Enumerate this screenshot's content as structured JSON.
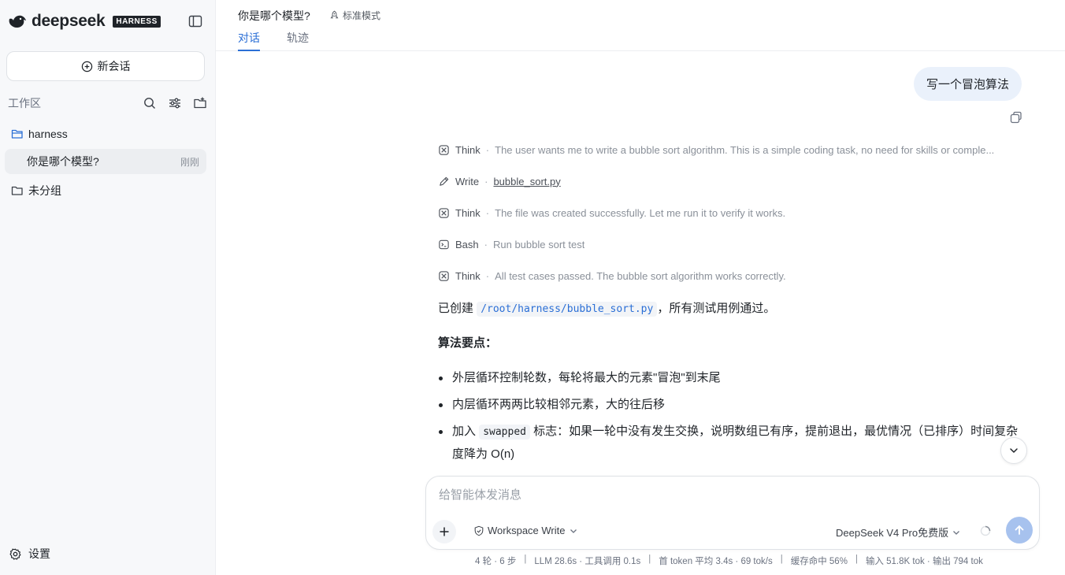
{
  "brand": {
    "wordmark": "deepseek",
    "badge": "HARNESS"
  },
  "sidebar": {
    "new_chat_label": "新会话",
    "workspace_label": "工作区",
    "groups": [
      {
        "label": "harness"
      },
      {
        "label": "未分组"
      }
    ],
    "sessions": [
      {
        "title": "你是哪个模型?",
        "time": "刚刚"
      }
    ],
    "settings_label": "设置"
  },
  "header": {
    "title": "你是哪个模型?",
    "mode": "标准模式",
    "tabs": [
      {
        "label": "对话",
        "active": true
      },
      {
        "label": "轨迹",
        "active": false
      }
    ]
  },
  "conversation": {
    "user_message": "写一个冒泡算法",
    "steps": [
      {
        "type": "Think",
        "icon": "brain-icon",
        "desc": "The user wants me to write a bubble sort algorithm. This is a simple coding task, no need for skills or comple..."
      },
      {
        "type": "Write",
        "icon": "pencil-icon",
        "link": "bubble_sort.py"
      },
      {
        "type": "Think",
        "icon": "brain-icon",
        "desc": "The file was created successfully. Let me run it to verify it works."
      },
      {
        "type": "Bash",
        "icon": "terminal-icon",
        "desc": "Run bubble sort test"
      },
      {
        "type": "Think",
        "icon": "brain-icon",
        "desc": "All test cases passed. The bubble sort algorithm works correctly."
      }
    ],
    "separator": "·",
    "answer": {
      "prefix": "已创建",
      "path": "/root/harness/bubble_sort.py",
      "suffix": "，所有测试用例通过。",
      "heading": "算法要点：",
      "bullets": [
        {
          "text": "外层循环控制轮数，每轮将最大的元素\"冒泡\"到末尾"
        },
        {
          "text": "内层循环两两比较相邻元素，大的往后移"
        },
        {
          "before": "加入",
          "code": "swapped",
          "after": "标志：如果一轮中没有发生交换，说明数组已有序，提前退出，最优情况（已排序）时间复杂度降为 O(n)"
        }
      ]
    }
  },
  "composer": {
    "placeholder": "给智能体发消息",
    "permission": "Workspace Write",
    "model": "DeepSeek V4 Pro免费版"
  },
  "stats": {
    "rounds": "4 轮 · 6 步",
    "llm": "LLM 28.6s · 工具调用 0.1s",
    "first_token": "首 token 平均 3.4s · 69 tok/s",
    "cache": "缓存命中 56%",
    "io": "输入 51.8K tok · 输出 794 tok",
    "divider": "|"
  },
  "colors": {
    "accent": "#2b6fd6",
    "user_bubble": "#eaf1fb",
    "send_disabled": "#a7c2ee",
    "sidebar_bg": "#f7f8fa"
  }
}
